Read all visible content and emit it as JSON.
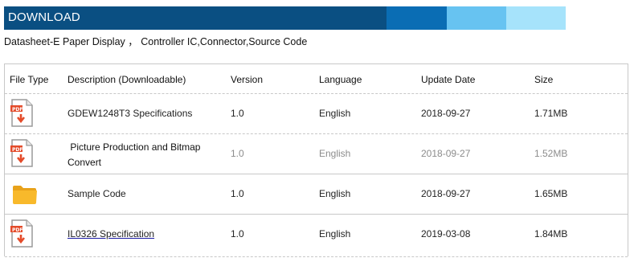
{
  "header": {
    "title": "DOWNLOAD",
    "colors": [
      "#0a4f82",
      "#0a6db4",
      "#67c3f1",
      "#a6e3fb"
    ]
  },
  "subtitle": "Datasheet-E Paper Display ， Controller IC,Connector,Source Code",
  "table": {
    "columns": [
      "File Type",
      "Description (Downloadable)",
      "Version",
      "Language",
      "Update Date",
      "Size"
    ],
    "rows": [
      {
        "icon": "pdf-icon",
        "description": "GDEW1248T3 Specifications",
        "version": "1.0",
        "language": "English",
        "date": "2018-09-27",
        "size": "1.71MB"
      },
      {
        "icon": "pdf-icon",
        "description": " Picture Production and Bitmap Convert",
        "version": "1.0",
        "language": "English",
        "date": "2018-09-27",
        "size": "1.52MB"
      },
      {
        "icon": "folder-icon",
        "description": "Sample Code",
        "version": "1.0",
        "language": "English",
        "date": "2018-09-27",
        "size": "1.65MB"
      },
      {
        "icon": "pdf-icon",
        "description": "IL0326 Specification",
        "version": "1.0",
        "language": "English",
        "date": "2019-03-08",
        "size": "1.84MB"
      }
    ]
  }
}
